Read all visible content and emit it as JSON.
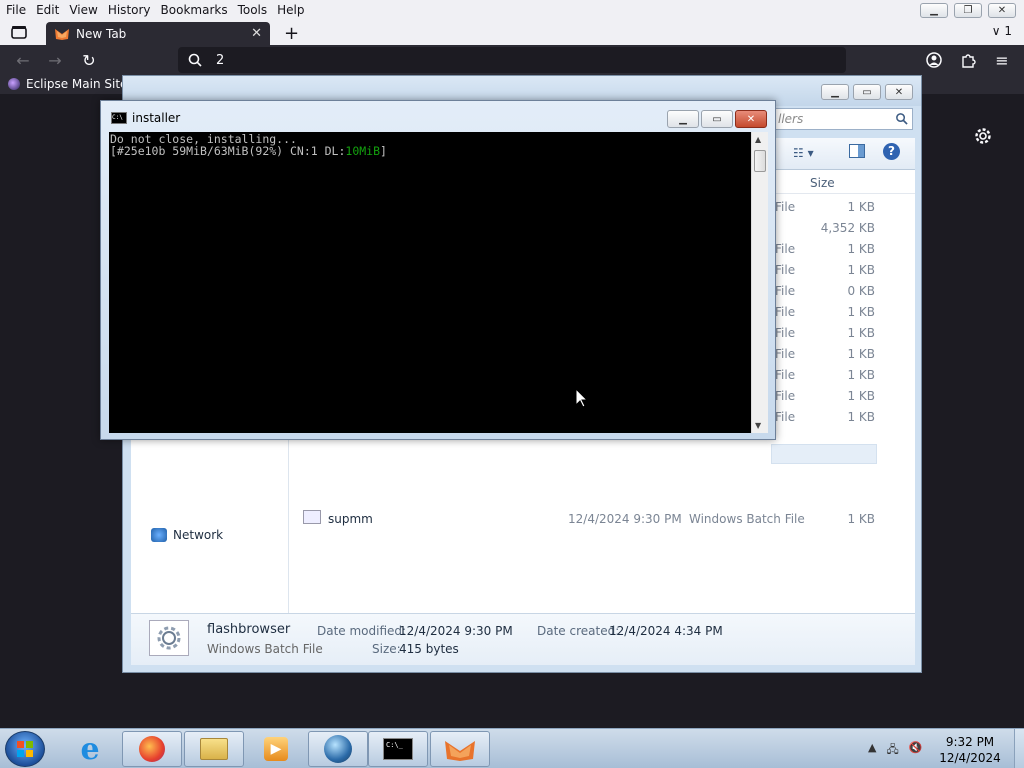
{
  "browser": {
    "menu": [
      "File",
      "Edit",
      "View",
      "History",
      "Bookmarks",
      "Tools",
      "Help"
    ],
    "tab_title": "New Tab",
    "all_tabs_label": "1",
    "url_text": "2",
    "bookmark": "Eclipse Main Site"
  },
  "explorer": {
    "search_placeholder": "llers",
    "size_header": "Size",
    "rows": [
      {
        "type": "File",
        "size": "1 KB"
      },
      {
        "type": "",
        "size": "4,352 KB"
      },
      {
        "type": "File",
        "size": "1 KB"
      },
      {
        "type": "File",
        "size": "1 KB"
      },
      {
        "type": "File",
        "size": "0 KB"
      },
      {
        "type": "File",
        "size": "1 KB"
      },
      {
        "type": "File",
        "size": "1 KB"
      },
      {
        "type": "File",
        "size": "1 KB"
      },
      {
        "type": "File",
        "size": "1 KB"
      },
      {
        "type": "File",
        "size": "1 KB"
      },
      {
        "type": "File",
        "size": "1 KB"
      }
    ],
    "last_row": {
      "name": "supmm",
      "date": "12/4/2024 9:30 PM",
      "type": "Windows Batch File",
      "size": "1 KB"
    },
    "network_label": "Network",
    "details": {
      "name": "flashbrowser",
      "kind": "Windows Batch File",
      "modified_label": "Date modified:",
      "modified_value": "12/4/2024 9:30 PM",
      "created_label": "Date created:",
      "created_value": "12/4/2024 4:34 PM",
      "size_label": "Size:",
      "size_value": "415 bytes"
    }
  },
  "console": {
    "title": "installer",
    "line1": "Do not close, installing...",
    "line2_prefix": "[#25e10b 59MiB/63MiB(92%) CN:1 DL:",
    "line2_speed": "10MiB",
    "line2_suffix": "]"
  },
  "taskbar": {
    "time": "9:32 PM",
    "date": "12/4/2024"
  }
}
